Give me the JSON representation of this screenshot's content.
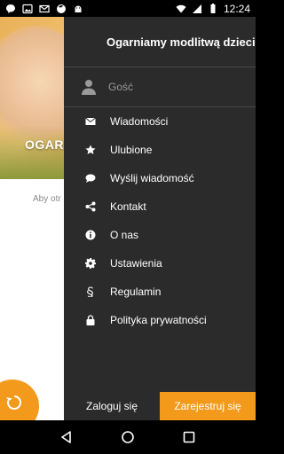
{
  "status_bar": {
    "time": "12:24",
    "left_icons": [
      "chat-bubble-icon",
      "image-icon",
      "mail-icon",
      "firefox-icon",
      "android-icon"
    ],
    "right_icons": [
      "wifi-icon",
      "signal-icon",
      "battery-icon"
    ]
  },
  "app": {
    "hero_title": "OGARI",
    "body_hint": "Aby otr",
    "fab_icon": "refresh-icon"
  },
  "drawer": {
    "title": "Ogarniamy modlitwą dzieci",
    "user": {
      "label": "Gość",
      "icon": "person-icon"
    },
    "items": [
      {
        "label": "Wiadomości",
        "icon": "envelope-icon"
      },
      {
        "label": "Ulubione",
        "icon": "star-icon"
      },
      {
        "label": "Wyślij wiadomość",
        "icon": "comment-icon"
      },
      {
        "label": "Kontakt",
        "icon": "share-icon"
      },
      {
        "label": "O nas",
        "icon": "info-icon"
      },
      {
        "label": "Ustawienia",
        "icon": "gear-icon"
      },
      {
        "label": "Regulamin",
        "icon": "section-icon"
      },
      {
        "label": "Polityka prywatności",
        "icon": "lock-icon"
      }
    ],
    "login_label": "Zaloguj się",
    "register_label": "Zarejestruj się"
  },
  "nav_bar": {
    "icons": [
      "back-icon",
      "home-icon",
      "recents-icon"
    ]
  },
  "colors": {
    "accent": "#f39a1d",
    "drawer_bg": "#2b2b2b",
    "divider": "#474747"
  }
}
